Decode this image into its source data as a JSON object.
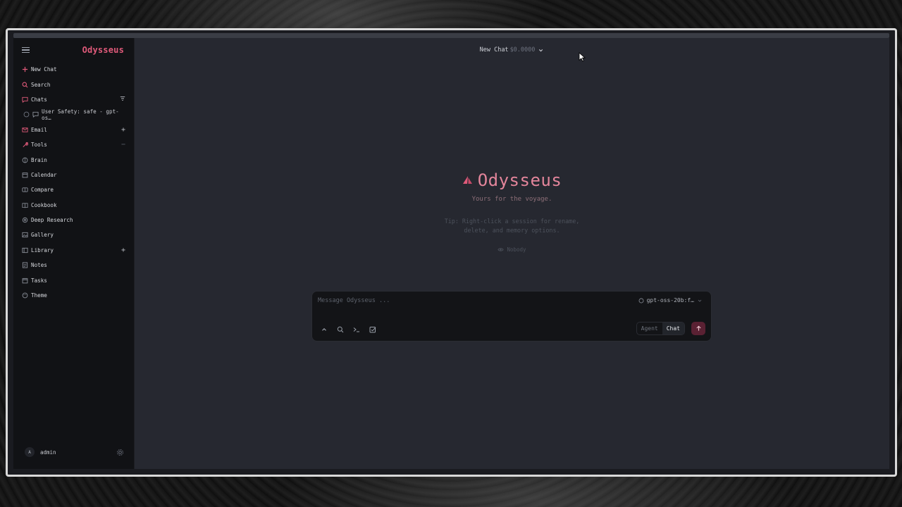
{
  "app": {
    "brand": "Odysseus"
  },
  "sidebar": {
    "items": [
      {
        "label": "New Chat",
        "icon": "plus-icon",
        "accent": "#e05a7a"
      },
      {
        "label": "Search",
        "icon": "search-icon",
        "accent": "#e05a7a"
      },
      {
        "label": "Chats",
        "icon": "chat-bubble-icon",
        "accent": "#e05a7a",
        "trail": "sort-icon"
      },
      {
        "label": "User Safety: safe - gpt-os…",
        "icon": "chat-bubble-icon",
        "sub": true
      },
      {
        "label": "Email",
        "icon": "mail-icon",
        "accent": "#e05a7a",
        "trail": "+"
      },
      {
        "label": "Tools",
        "icon": "wrench-icon",
        "accent": "#e05a7a",
        "trail": "−"
      },
      {
        "label": "Brain",
        "icon": "brain-icon"
      },
      {
        "label": "Calendar",
        "icon": "calendar-icon"
      },
      {
        "label": "Compare",
        "icon": "compare-icon"
      },
      {
        "label": "Cookbook",
        "icon": "book-icon"
      },
      {
        "label": "Deep Research",
        "icon": "research-icon"
      },
      {
        "label": "Gallery",
        "icon": "image-icon"
      },
      {
        "label": "Library",
        "icon": "library-icon",
        "trail": "+"
      },
      {
        "label": "Notes",
        "icon": "note-icon"
      },
      {
        "label": "Tasks",
        "icon": "tasks-icon"
      },
      {
        "label": "Theme",
        "icon": "palette-icon"
      }
    ],
    "user": {
      "avatar_letter": "A",
      "name": "admin"
    }
  },
  "header": {
    "title": "New Chat",
    "cost": "$0.0000"
  },
  "hero": {
    "title": "Odysseus",
    "tagline": "Yours for the voyage.",
    "tip_line1": "Tip: Right-click a session for rename,",
    "tip_line2": "delete, and memory options.",
    "memory_label": "Nobody"
  },
  "composer": {
    "placeholder": "Message Odysseus ...",
    "model": "gpt-oss-20b:f…",
    "mode_agent": "Agent",
    "mode_chat": "Chat"
  },
  "colors": {
    "accent": "#e05a7a",
    "send_bg": "#5a2133",
    "main_bg": "#262830",
    "sidebar_bg": "#111215"
  }
}
